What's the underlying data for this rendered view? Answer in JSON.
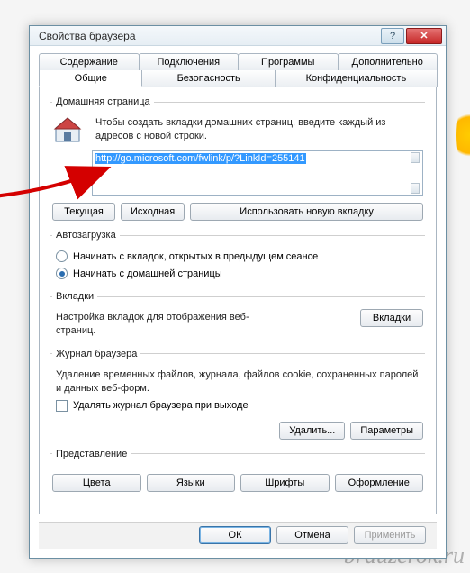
{
  "watermark": "brauzerok.ru",
  "dialog": {
    "title": "Свойства браузера",
    "help_icon": "?",
    "close_icon": "✕"
  },
  "tabs": {
    "row1": [
      "Содержание",
      "Подключения",
      "Программы",
      "Дополнительно"
    ],
    "row2": [
      "Общие",
      "Безопасность",
      "Конфиденциальность"
    ],
    "active": "Общие"
  },
  "homepage": {
    "legend": "Домашняя страница",
    "hint": "Чтобы создать вкладки домашних страниц, введите каждый из адресов с новой строки.",
    "url": "http://go.microsoft.com/fwlink/p/?LinkId=255141",
    "btn_current": "Текущая",
    "btn_default": "Исходная",
    "btn_newtab": "Использовать новую вкладку"
  },
  "startup": {
    "legend": "Автозагрузка",
    "opt_tabs": "Начинать с вкладок, открытых в предыдущем сеансе",
    "opt_home": "Начинать с домашней страницы",
    "selected": "home"
  },
  "tabs_section": {
    "legend": "Вкладки",
    "desc": "Настройка вкладок для отображения веб-страниц.",
    "btn": "Вкладки"
  },
  "history": {
    "legend": "Журнал браузера",
    "desc": "Удаление временных файлов, журнала, файлов cookie, сохраненных паролей и данных веб-форм.",
    "check_label": "Удалять журнал браузера при выходе",
    "btn_delete": "Удалить...",
    "btn_params": "Параметры"
  },
  "appearance": {
    "legend": "Представление",
    "btn_colors": "Цвета",
    "btn_langs": "Языки",
    "btn_fonts": "Шрифты",
    "btn_access": "Оформление"
  },
  "buttons": {
    "ok": "ОК",
    "cancel": "Отмена",
    "apply": "Применить"
  }
}
